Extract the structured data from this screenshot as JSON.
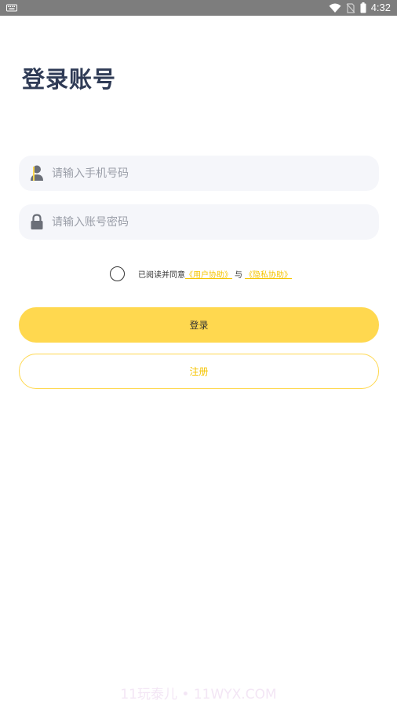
{
  "status_bar": {
    "time": "4:32",
    "icons": [
      "keyboard-icon",
      "wifi-icon",
      "no-sim-icon",
      "battery-icon"
    ],
    "background": "#7d7d7d"
  },
  "page": {
    "title": "登录账号"
  },
  "phone_field": {
    "icon": "user-icon",
    "placeholder": "请输入手机号码",
    "value": ""
  },
  "password_field": {
    "icon": "lock-icon",
    "placeholder": "请输入账号密码",
    "value": ""
  },
  "agreement": {
    "checked": false,
    "prefix": "已阅读并同意",
    "user_agreement": "《用户协助》",
    "separator": "与",
    "privacy_agreement": "《隐私协助》"
  },
  "buttons": {
    "login": "登录",
    "register": "注册"
  },
  "watermark": "11玩泰儿 • 11WYX.COM",
  "colors": {
    "accent": "#ffd84f",
    "link": "#f5c400",
    "title": "#2f3b56",
    "field_bg": "#f5f6fa"
  }
}
